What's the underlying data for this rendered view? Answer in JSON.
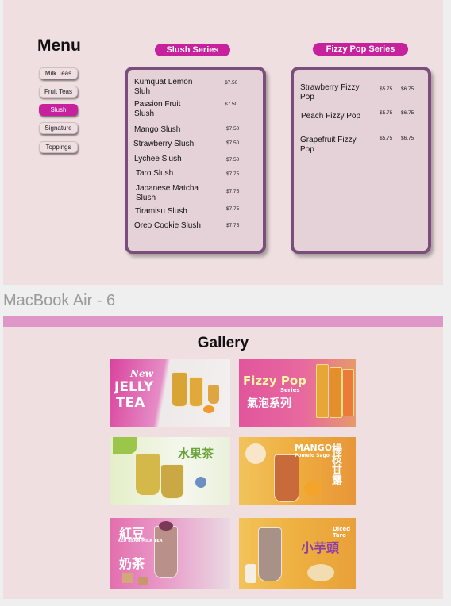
{
  "menu": {
    "title": "Menu",
    "nav": [
      "Milk Teas",
      "Fruit Teas",
      "Slush",
      "Signature",
      "Toppings"
    ],
    "active_index": 2
  },
  "slush": {
    "title": "Slush Series",
    "items": [
      {
        "name": "Kumquat Lemon Sluh",
        "price": "$7.50"
      },
      {
        "name": "Passion Fruit Slush",
        "price": "$7.50"
      },
      {
        "name": "Mango Slush",
        "price": "$7.50"
      },
      {
        "name": "Strawberry Slush",
        "price": "$7.50"
      },
      {
        "name": "Lychee Slush",
        "price": "$7.50"
      },
      {
        "name": "Taro Slush",
        "price": "$7.75"
      },
      {
        "name": "Japanese Matcha Slush",
        "price": "$7.75"
      },
      {
        "name": "Tiramisu Slush",
        "price": "$7.75"
      },
      {
        "name": "Oreo Cookie Slush",
        "price": "$7.75"
      }
    ]
  },
  "fizzy": {
    "title": "Fizzy Pop Series",
    "items": [
      {
        "name": "Strawberry Fizzy Pop",
        "price_m": "$5.75",
        "price_l": "$6.75"
      },
      {
        "name": "Peach Fizzy Pop",
        "price_m": "$5.75",
        "price_l": "$6.75"
      },
      {
        "name": "Grapefruit Fizzy Pop",
        "price_m": "$5.75",
        "price_l": "$6.75"
      }
    ]
  },
  "frame_label": "MacBook Air - 6",
  "gallery": {
    "title": "Gallery",
    "tiles": [
      {
        "text1": "New",
        "text2": "JELLY",
        "text3": "TEA"
      },
      {
        "text1": "Fizzy Pop",
        "text2": "Series",
        "text3": "氣泡系列"
      },
      {
        "text1": "水果茶",
        "text2": "",
        "text3": ""
      },
      {
        "text1": "MANGO",
        "text2": "Pomelo Sago",
        "text3": "楊枝甘露"
      },
      {
        "text1": "紅豆",
        "text2": "RED BEAN MILK TEA",
        "text3": "奶茶"
      },
      {
        "text1": "Diced Taro",
        "text2": "小芋頭",
        "text3": ""
      }
    ]
  }
}
